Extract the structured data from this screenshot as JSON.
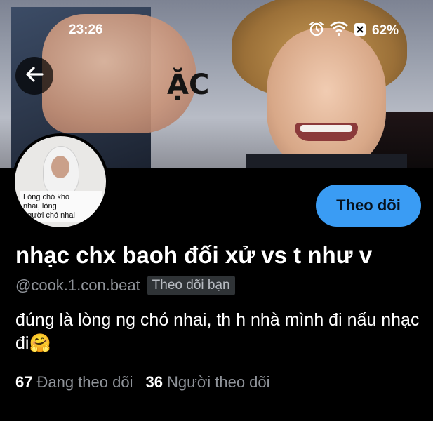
{
  "status_bar": {
    "time": "23:26",
    "battery": "62%"
  },
  "banner": {
    "caption": "ẶC"
  },
  "avatar": {
    "sign_lines": [
      "Lòng  chó  khó",
      "nhai,           lòng",
      "người chó nhai"
    ]
  },
  "actions": {
    "follow_label": "Theo dõi"
  },
  "profile": {
    "display_name": "nhạc chx baoh đối xử vs t như v",
    "handle": "@cook.1.con.beat",
    "follows_you": "Theo dõi bạn",
    "bio": "đúng là lòng ng chó nhai, th h nhà mình đi nấu nhạc đi🤗"
  },
  "stats": {
    "following_count": "67",
    "following_label": "Đang theo dõi",
    "followers_count": "36",
    "followers_label": "Người theo dõi"
  },
  "colors": {
    "accent": "#3a9cf4",
    "background": "#000000",
    "muted_text": "#8f9399"
  },
  "icons": [
    "alarm-icon",
    "wifi-icon",
    "battery-icon",
    "back-arrow-icon"
  ]
}
